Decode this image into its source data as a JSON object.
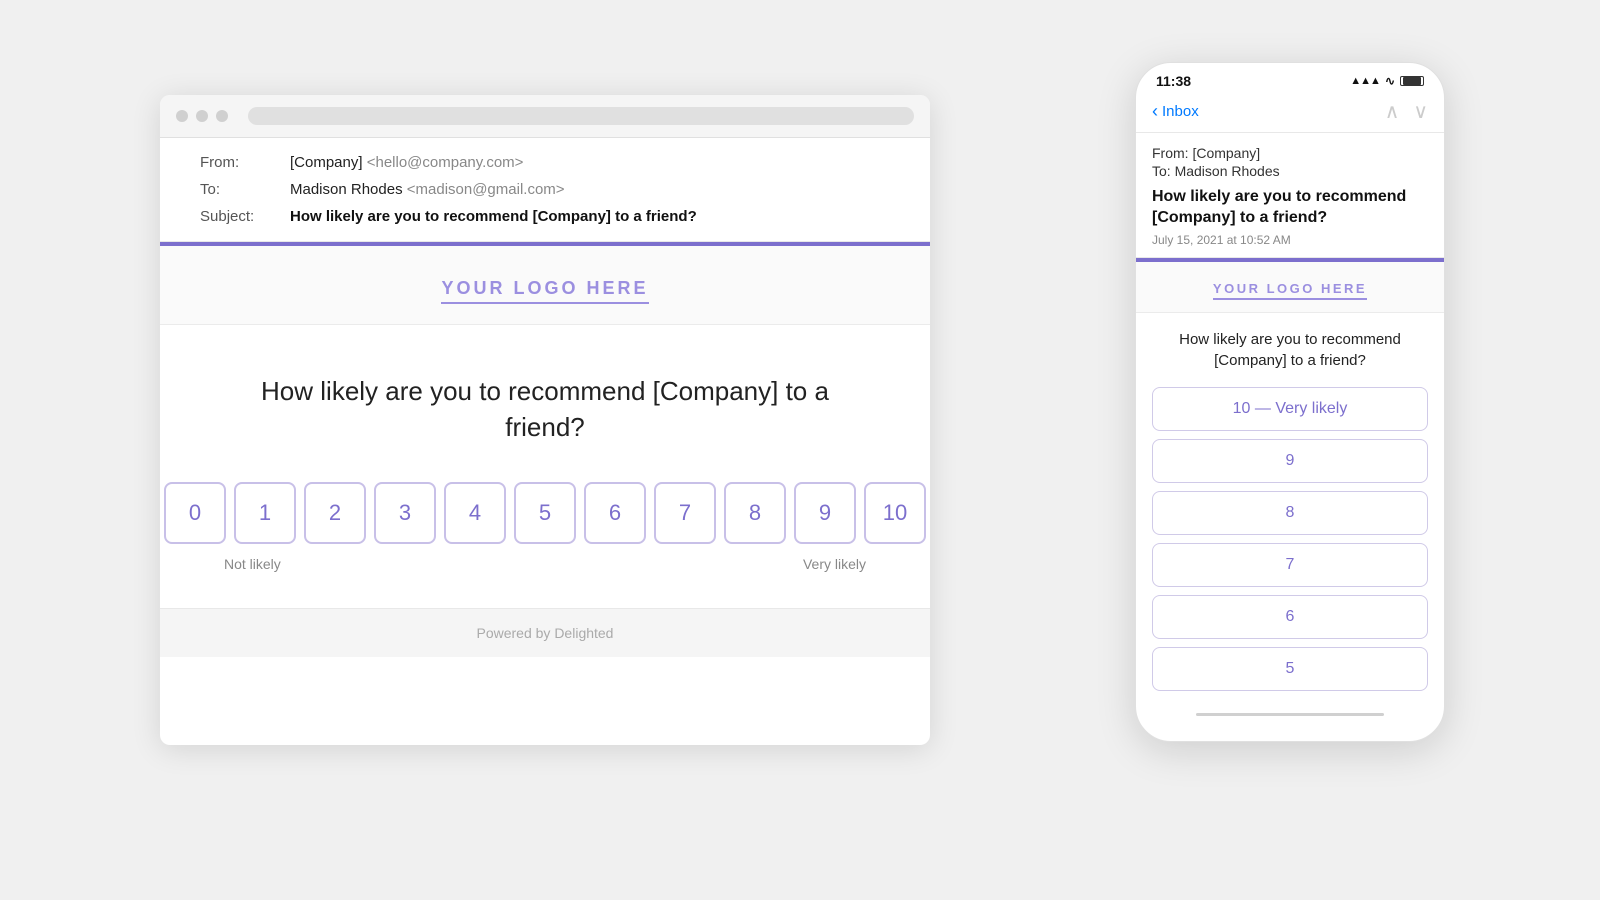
{
  "desktop": {
    "email_header": {
      "from_label": "From:",
      "from_value": "[Company]",
      "from_email": "<hello@company.com>",
      "to_label": "To:",
      "to_value": "Madison Rhodes",
      "to_email": "<madison@gmail.com>",
      "subject_label": "Subject:",
      "subject_text": "How likely are you to recommend [Company] to a friend?"
    },
    "logo": "YOUR LOGO HERE",
    "nps_question": "How likely are you to recommend [Company] to a friend?",
    "nps_scores": [
      "0",
      "1",
      "2",
      "3",
      "4",
      "5",
      "6",
      "7",
      "8",
      "9",
      "10"
    ],
    "label_low": "Not likely",
    "label_high": "Very likely",
    "footer": "Powered by Delighted"
  },
  "mobile": {
    "status_time": "11:38",
    "signal_icon": "▲▲▲",
    "wifi_icon": "WiFi",
    "battery_icon": "🔋",
    "back_label": "Inbox",
    "nav_up": "∧",
    "nav_down": "∨",
    "from_text": "From: [Company]",
    "to_text": "To: Madison Rhodes",
    "subject_text": "How likely are you to recommend [Company] to a friend?",
    "date_text": "July 15, 2021 at 10:52 AM",
    "logo": "YOUR LOGO HERE",
    "question": "How likely are you to recommend [Company] to a friend?",
    "nps_items": [
      {
        "label": "10 — Very likely"
      },
      {
        "label": "9"
      },
      {
        "label": "8"
      },
      {
        "label": "7"
      },
      {
        "label": "6"
      },
      {
        "label": "5"
      }
    ]
  },
  "colors": {
    "purple": "#7c6fcd",
    "purple_light": "#9b8fe0",
    "purple_border": "#c8c0e8"
  }
}
